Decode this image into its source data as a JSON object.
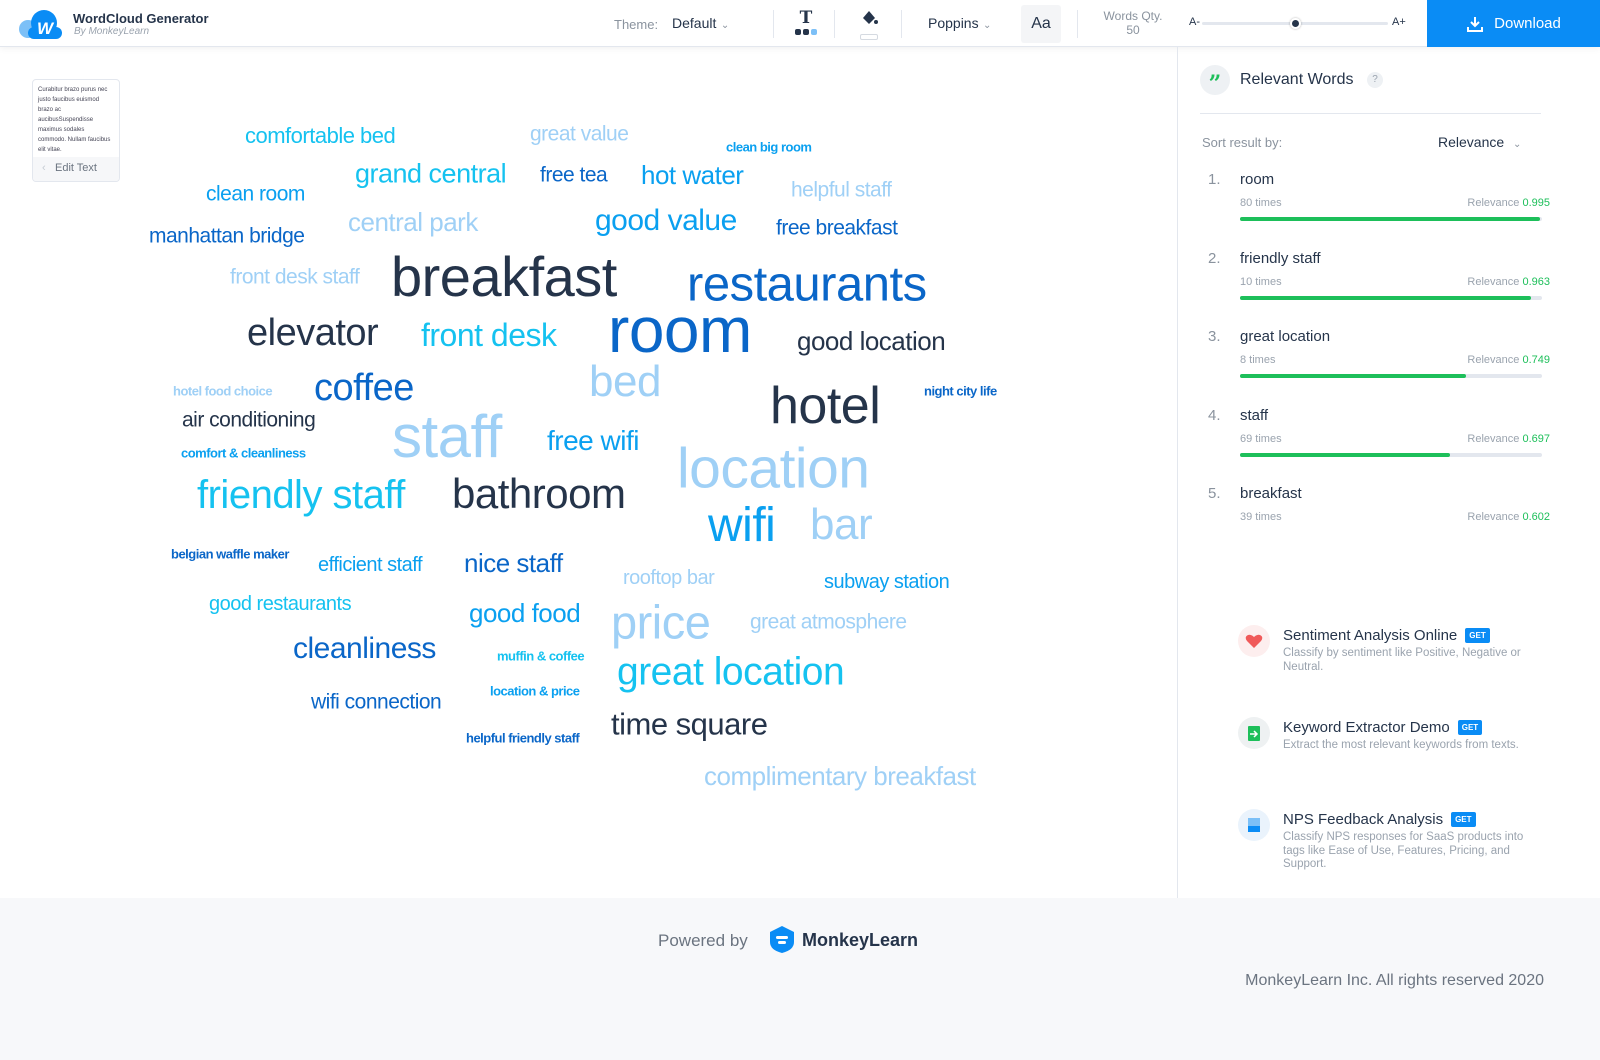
{
  "header": {
    "app_title": "WordCloud Generator",
    "app_subtitle": "By MonkeyLearn",
    "logo_letter": "W",
    "theme_label": "Theme:",
    "theme_value": "Default",
    "font_value": "Poppins",
    "case_label": "Aa",
    "words_qty_label": "Words Qty.",
    "words_qty_value": "50",
    "size_min_label": "A-",
    "size_max_label": "A+",
    "size_slider_level": 0.5,
    "download_label": "Download"
  },
  "editor": {
    "preview_text": "Curabitur brazo purus nec justo faucibus euismod brazo ac aucibusSuspendisse maximus sodales commodo. Nullam faucibus elit vitae.",
    "edit_label": "Edit Text"
  },
  "colors": {
    "dark": "#25344a",
    "navy_blue": "#0a66c8",
    "blue": "#0aa0f0",
    "cyan": "#15c2f0",
    "light_blue": "#9fd0f6",
    "accent": "#0a8cf5",
    "relevance_green": "#1dbf5a"
  },
  "cloud": {
    "words": [
      {
        "text": "comfortable bed",
        "color": "cyan"
      },
      {
        "text": "great value",
        "color": "light_blue"
      },
      {
        "text": "clean big room",
        "color": "blue"
      },
      {
        "text": "grand central",
        "color": "cyan"
      },
      {
        "text": "free tea",
        "color": "navy_blue"
      },
      {
        "text": "hot water",
        "color": "blue"
      },
      {
        "text": "helpful staff",
        "color": "light_blue"
      },
      {
        "text": "clean room",
        "color": "blue"
      },
      {
        "text": "central park",
        "color": "light_blue"
      },
      {
        "text": "good value",
        "color": "blue"
      },
      {
        "text": "free breakfast",
        "color": "navy_blue"
      },
      {
        "text": "manhattan bridge",
        "color": "navy_blue"
      },
      {
        "text": "front desk staff",
        "color": "light_blue"
      },
      {
        "text": "breakfast",
        "color": "dark"
      },
      {
        "text": "restaurants",
        "color": "navy_blue"
      },
      {
        "text": "elevator",
        "color": "dark"
      },
      {
        "text": "front desk",
        "color": "cyan"
      },
      {
        "text": "room",
        "color": "navy_blue"
      },
      {
        "text": "good location",
        "color": "dark"
      },
      {
        "text": "hotel food choice",
        "color": "light_blue"
      },
      {
        "text": "coffee",
        "color": "navy_blue"
      },
      {
        "text": "bed",
        "color": "light_blue"
      },
      {
        "text": "hotel",
        "color": "dark"
      },
      {
        "text": "night city life",
        "color": "navy_blue"
      },
      {
        "text": "air conditioning",
        "color": "dark"
      },
      {
        "text": "staff",
        "color": "light_blue"
      },
      {
        "text": "free wifi",
        "color": "blue"
      },
      {
        "text": "comfort & cleanliness",
        "color": "blue"
      },
      {
        "text": "location",
        "color": "light_blue"
      },
      {
        "text": "friendly staff",
        "color": "cyan"
      },
      {
        "text": "bathroom",
        "color": "dark"
      },
      {
        "text": "wifi",
        "color": "blue"
      },
      {
        "text": "bar",
        "color": "light_blue"
      },
      {
        "text": "belgian waffle maker",
        "color": "navy_blue"
      },
      {
        "text": "efficient staff",
        "color": "blue"
      },
      {
        "text": "nice staff",
        "color": "navy_blue"
      },
      {
        "text": "rooftop bar",
        "color": "light_blue"
      },
      {
        "text": "subway station",
        "color": "blue"
      },
      {
        "text": "good restaurants",
        "color": "cyan"
      },
      {
        "text": "good food",
        "color": "blue"
      },
      {
        "text": "price",
        "color": "light_blue"
      },
      {
        "text": "great atmosphere",
        "color": "light_blue"
      },
      {
        "text": "cleanliness",
        "color": "navy_blue"
      },
      {
        "text": "muffin & coffee",
        "color": "cyan"
      },
      {
        "text": "great location",
        "color": "cyan"
      },
      {
        "text": "wifi connection",
        "color": "navy_blue"
      },
      {
        "text": "location & price",
        "color": "blue"
      },
      {
        "text": "helpful friendly staff",
        "color": "navy_blue"
      },
      {
        "text": "time square",
        "color": "dark"
      },
      {
        "text": "complimentary breakfast",
        "color": "light_blue"
      }
    ]
  },
  "panel": {
    "title": "Relevant Words",
    "help": "?",
    "sort_label": "Sort result by:",
    "sort_value": "Relevance",
    "results": [
      {
        "rank": "1.",
        "word": "room",
        "times": "80 times",
        "relevance_label": "Relevance",
        "relevance": "0.995"
      },
      {
        "rank": "2.",
        "word": "friendly staff",
        "times": "10 times",
        "relevance_label": "Relevance",
        "relevance": "0.963"
      },
      {
        "rank": "3.",
        "word": "great location",
        "times": "8 times",
        "relevance_label": "Relevance",
        "relevance": "0.749"
      },
      {
        "rank": "4.",
        "word": "staff",
        "times": "69 times",
        "relevance_label": "Relevance",
        "relevance": "0.697"
      },
      {
        "rank": "5.",
        "word": "breakfast",
        "times": "39 times",
        "relevance_label": "Relevance",
        "relevance": "0.602"
      }
    ],
    "promos": [
      {
        "title": "Sentiment Analysis Online",
        "badge": "GET",
        "desc": "Classify by sentiment like Positive, Negative or Neutral.",
        "icon": "heart-icon"
      },
      {
        "title": "Keyword Extractor Demo",
        "badge": "GET",
        "desc": "Extract the most relevant keywords from texts.",
        "icon": "document-arrow-icon"
      },
      {
        "title": "NPS Feedback Analysis",
        "badge": "GET",
        "desc": "Classify NPS responses for SaaS products into tags like Ease of Use, Features, Pricing, and Support.",
        "icon": "form-check-icon"
      }
    ]
  },
  "footer": {
    "powered_by": "Powered by",
    "brand": "MonkeyLearn",
    "copyright": "MonkeyLearn Inc. All rights reserved 2020"
  }
}
